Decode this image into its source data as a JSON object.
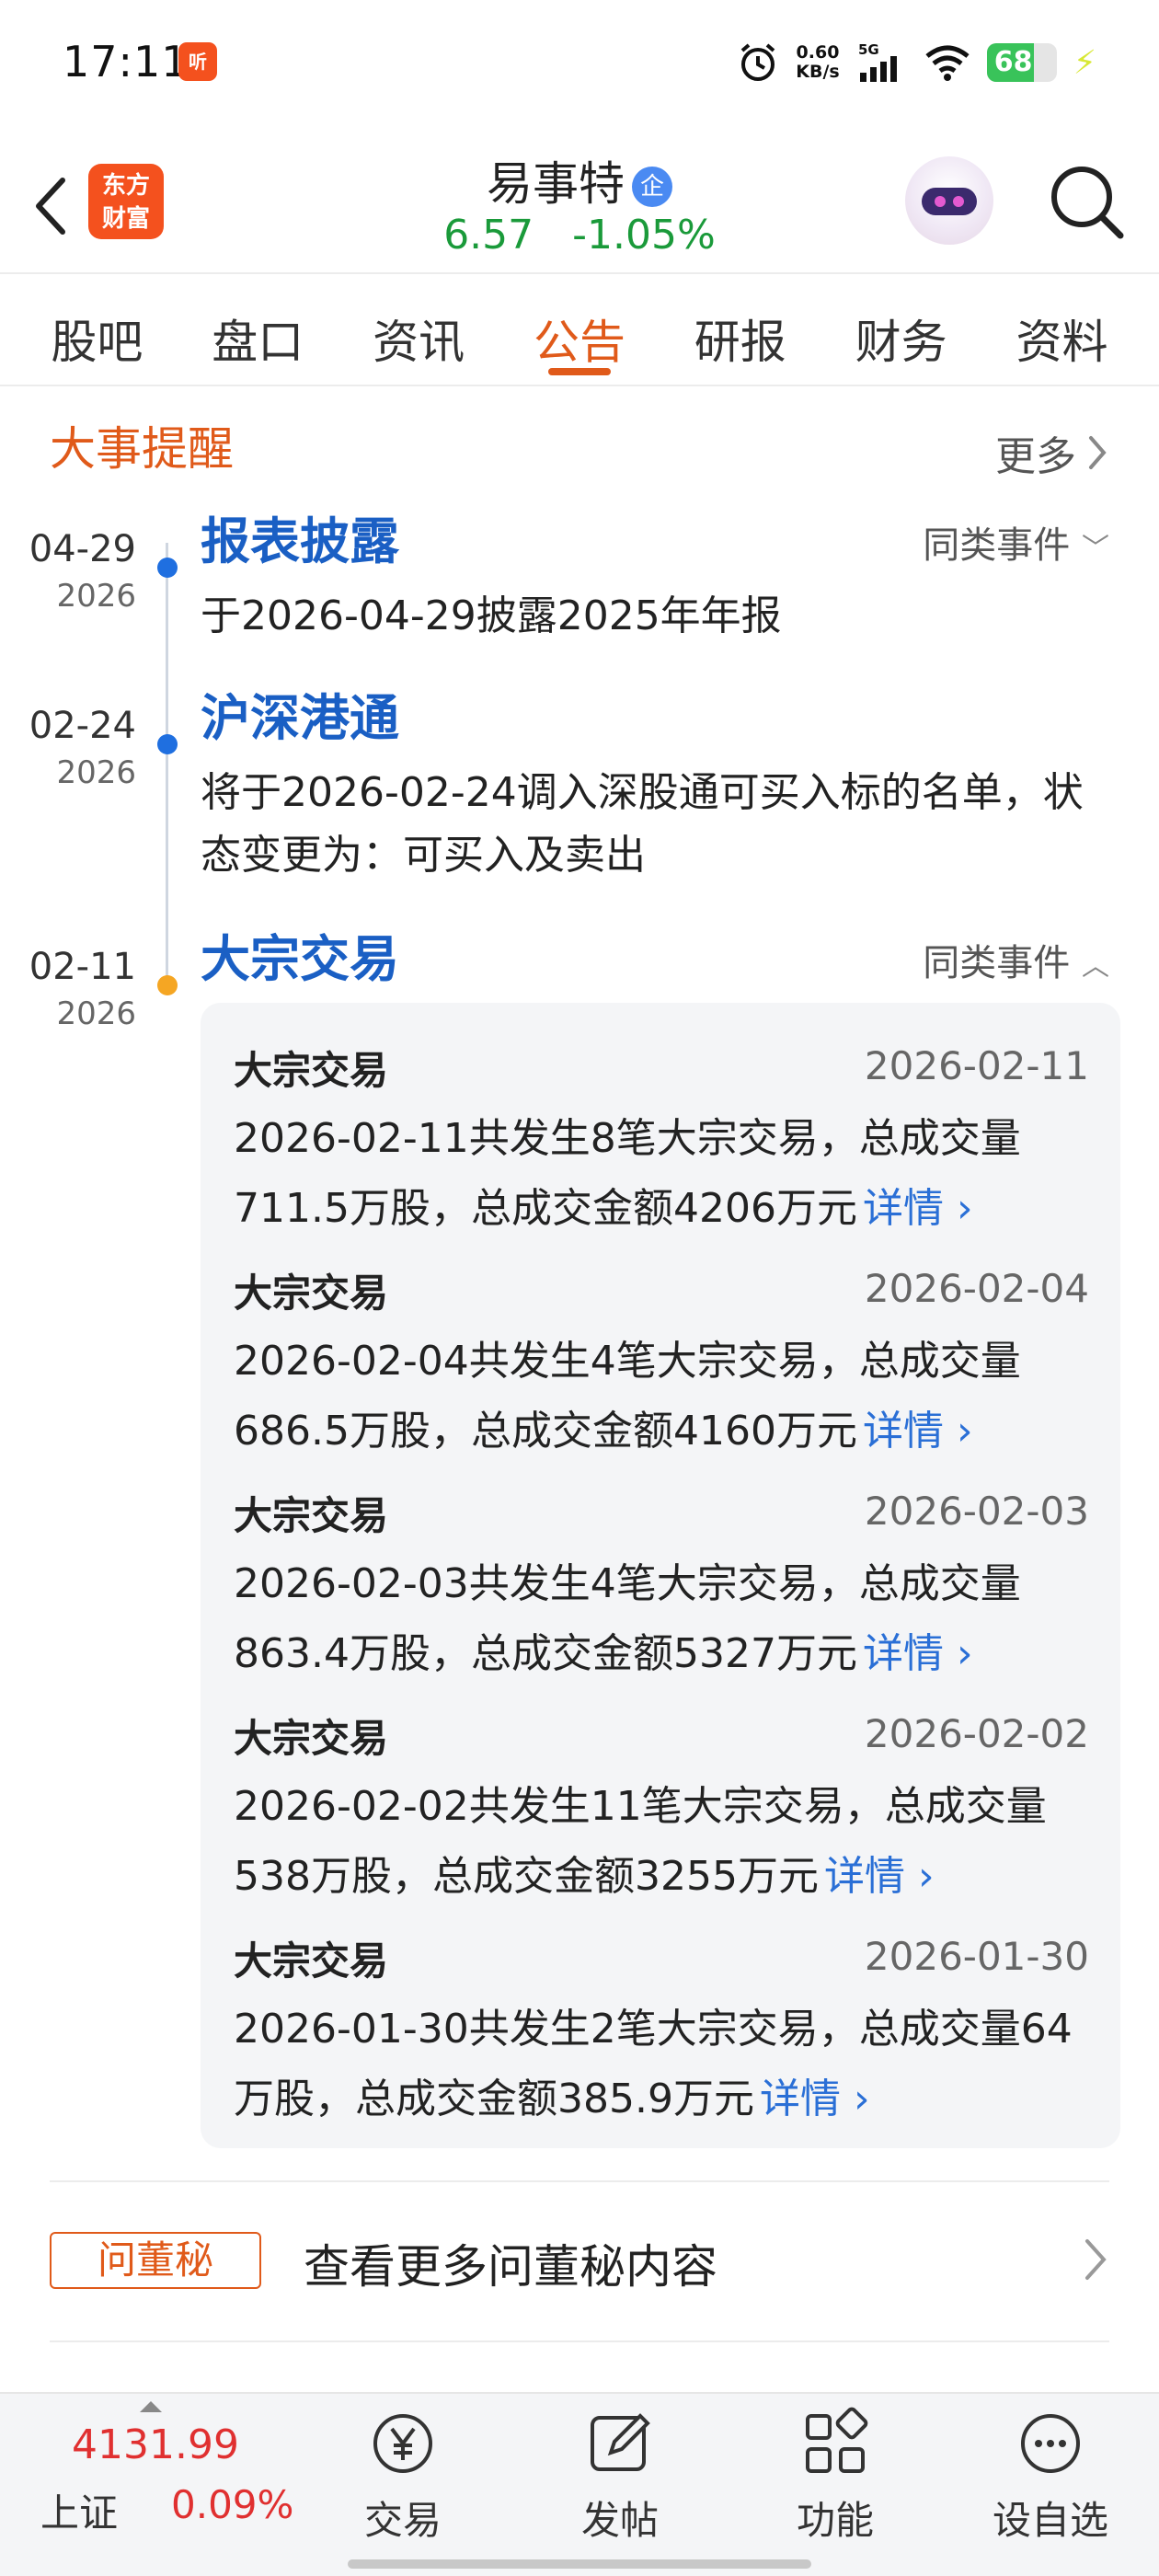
{
  "status_bar": {
    "time": "17:11",
    "app_icon_text": "听",
    "speed_value": "0.60",
    "speed_unit": "KB/s",
    "network": "5G",
    "battery": "68",
    "battery_level": 0.68
  },
  "header": {
    "logo_line1": "东方",
    "logo_line2": "财富",
    "stock_name": "易事特",
    "badge": "企",
    "price": "6.57",
    "change_pct": "-1.05%"
  },
  "tabs": [
    {
      "label": "股吧",
      "active": false
    },
    {
      "label": "盘口",
      "active": false
    },
    {
      "label": "资讯",
      "active": false
    },
    {
      "label": "公告",
      "active": true
    },
    {
      "label": "研报",
      "active": false
    },
    {
      "label": "财务",
      "active": false
    },
    {
      "label": "资料",
      "active": false
    }
  ],
  "events_section": {
    "title": "大事提醒",
    "more_label": "更多"
  },
  "timeline": [
    {
      "date": "04-29",
      "year": "2026",
      "title": "报表披露",
      "similar_label": "同类事件",
      "desc": "于2026-04-29披露2025年年报",
      "dot_color": "#1f6fe0"
    },
    {
      "date": "02-24",
      "year": "2026",
      "title": "沪深港通",
      "desc_line1": "将于2026-02-24调入深股通可买入标的名单，状",
      "desc_line2": "态变更为：可买入及卖出",
      "dot_color": "#1f6fe0"
    },
    {
      "date": "02-11",
      "year": "2026",
      "title": "大宗交易",
      "similar_label": "同类事件",
      "dot_color": "#f5a623"
    }
  ],
  "block_trades": [
    {
      "name": "大宗交易",
      "date": "2026-02-11",
      "line1": "2026-02-11共发生8笔大宗交易，总成交量",
      "line2": "711.5万股，总成交金额4206万元",
      "detail": "详情"
    },
    {
      "name": "大宗交易",
      "date": "2026-02-04",
      "line1": "2026-02-04共发生4笔大宗交易，总成交量",
      "line2": "686.5万股，总成交金额4160万元",
      "detail": "详情"
    },
    {
      "name": "大宗交易",
      "date": "2026-02-03",
      "line1": "2026-02-03共发生4笔大宗交易，总成交量",
      "line2": "863.4万股，总成交金额5327万元",
      "detail": "详情"
    },
    {
      "name": "大宗交易",
      "date": "2026-02-02",
      "line1": "2026-02-02共发生11笔大宗交易，总成交量",
      "line2": "538万股，总成交金额3255万元",
      "detail": "详情"
    },
    {
      "name": "大宗交易",
      "date": "2026-01-30",
      "line1": "2026-01-30共发生2笔大宗交易，总成交量64",
      "line2": "万股，总成交金额385.9万元",
      "detail": "详情"
    }
  ],
  "dong_mi": {
    "badge": "问董秘",
    "text": "查看更多问董秘内容"
  },
  "bottom_nav": {
    "index_value": "4131.99",
    "index_name": "上证",
    "index_change": "0.09%",
    "items": [
      {
        "label": "交易",
        "icon": "yuan-icon"
      },
      {
        "label": "发帖",
        "icon": "edit-icon"
      },
      {
        "label": "功能",
        "icon": "grid-icon"
      },
      {
        "label": "设自选",
        "icon": "more-icon"
      }
    ]
  },
  "colors": {
    "accent": "#e05a1a",
    "link": "#2a6fd6",
    "up": "#e03030",
    "down": "#1a9a3a"
  }
}
